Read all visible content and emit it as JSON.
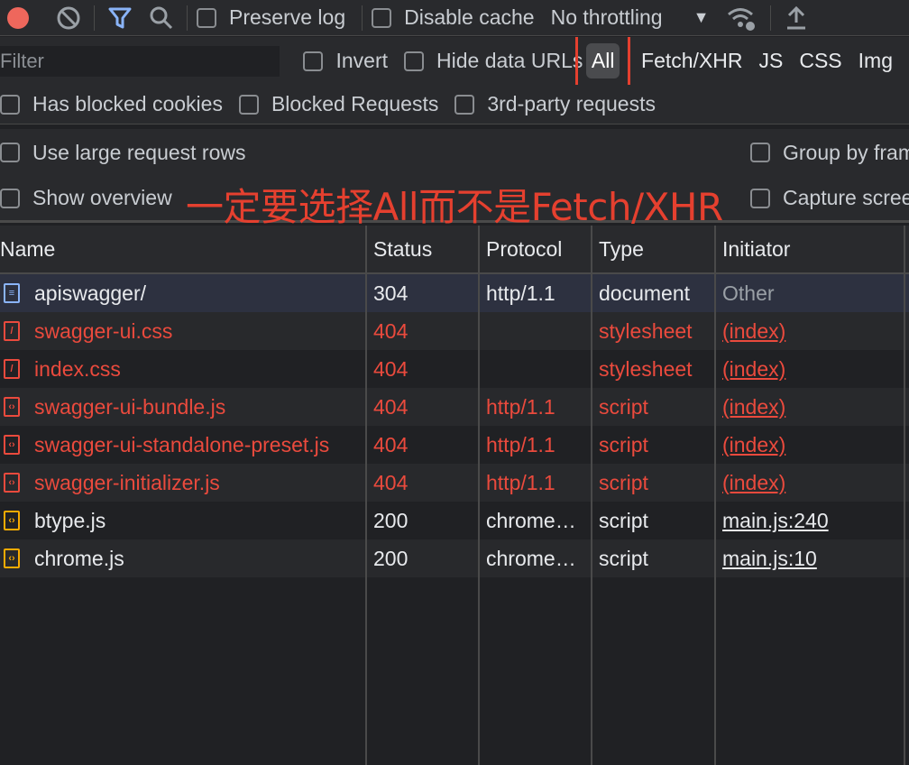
{
  "colors": {
    "accent": "#8ab4f8",
    "error": "#ea4a3d",
    "annotation": "#e5402f",
    "record": "#ee675c"
  },
  "toolbar": {
    "preserve_log": "Preserve log",
    "disable_cache": "Disable cache",
    "throttling": "No throttling"
  },
  "filter": {
    "placeholder": "Filter",
    "invert": "Invert",
    "hide_data_urls": "Hide data URLs",
    "types": [
      "All",
      "Fetch/XHR",
      "JS",
      "CSS",
      "Img"
    ],
    "active_type": "All"
  },
  "options": {
    "has_blocked_cookies": "Has blocked cookies",
    "blocked_requests": "Blocked Requests",
    "third_party": "3rd-party requests"
  },
  "settings": {
    "large_rows": "Use large request rows",
    "group_by_frame": "Group by frame",
    "show_overview": "Show overview",
    "capture_screenshots": "Capture screenshots"
  },
  "annotation": "一定要选择All而不是Fetch/XHR",
  "table": {
    "headers": {
      "name": "Name",
      "status": "Status",
      "protocol": "Protocol",
      "type": "Type",
      "initiator": "Initiator"
    },
    "rows": [
      {
        "name": "apiswagger/",
        "status": "304",
        "protocol": "http/1.1",
        "type": "document",
        "initiator": "Other",
        "icon": "document-icon",
        "error": false
      },
      {
        "name": "swagger-ui.css",
        "status": "404",
        "protocol": "",
        "type": "stylesheet",
        "initiator": "(index)",
        "icon": "stylesheet-icon",
        "error": true
      },
      {
        "name": "index.css",
        "status": "404",
        "protocol": "",
        "type": "stylesheet",
        "initiator": "(index)",
        "icon": "stylesheet-icon",
        "error": true
      },
      {
        "name": "swagger-ui-bundle.js",
        "status": "404",
        "protocol": "http/1.1",
        "type": "script",
        "initiator": "(index)",
        "icon": "script-icon",
        "error": true
      },
      {
        "name": "swagger-ui-standalone-preset.js",
        "status": "404",
        "protocol": "http/1.1",
        "type": "script",
        "initiator": "(index)",
        "icon": "script-icon",
        "error": true
      },
      {
        "name": "swagger-initializer.js",
        "status": "404",
        "protocol": "http/1.1",
        "type": "script",
        "initiator": "(index)",
        "icon": "script-icon",
        "error": true
      },
      {
        "name": "btype.js",
        "status": "200",
        "protocol": "chrome…",
        "type": "script",
        "initiator": "main.js:240",
        "icon": "script-icon",
        "error": false
      },
      {
        "name": "chrome.js",
        "status": "200",
        "protocol": "chrome…",
        "type": "script",
        "initiator": "main.js:10",
        "icon": "script-icon",
        "error": false
      }
    ]
  }
}
